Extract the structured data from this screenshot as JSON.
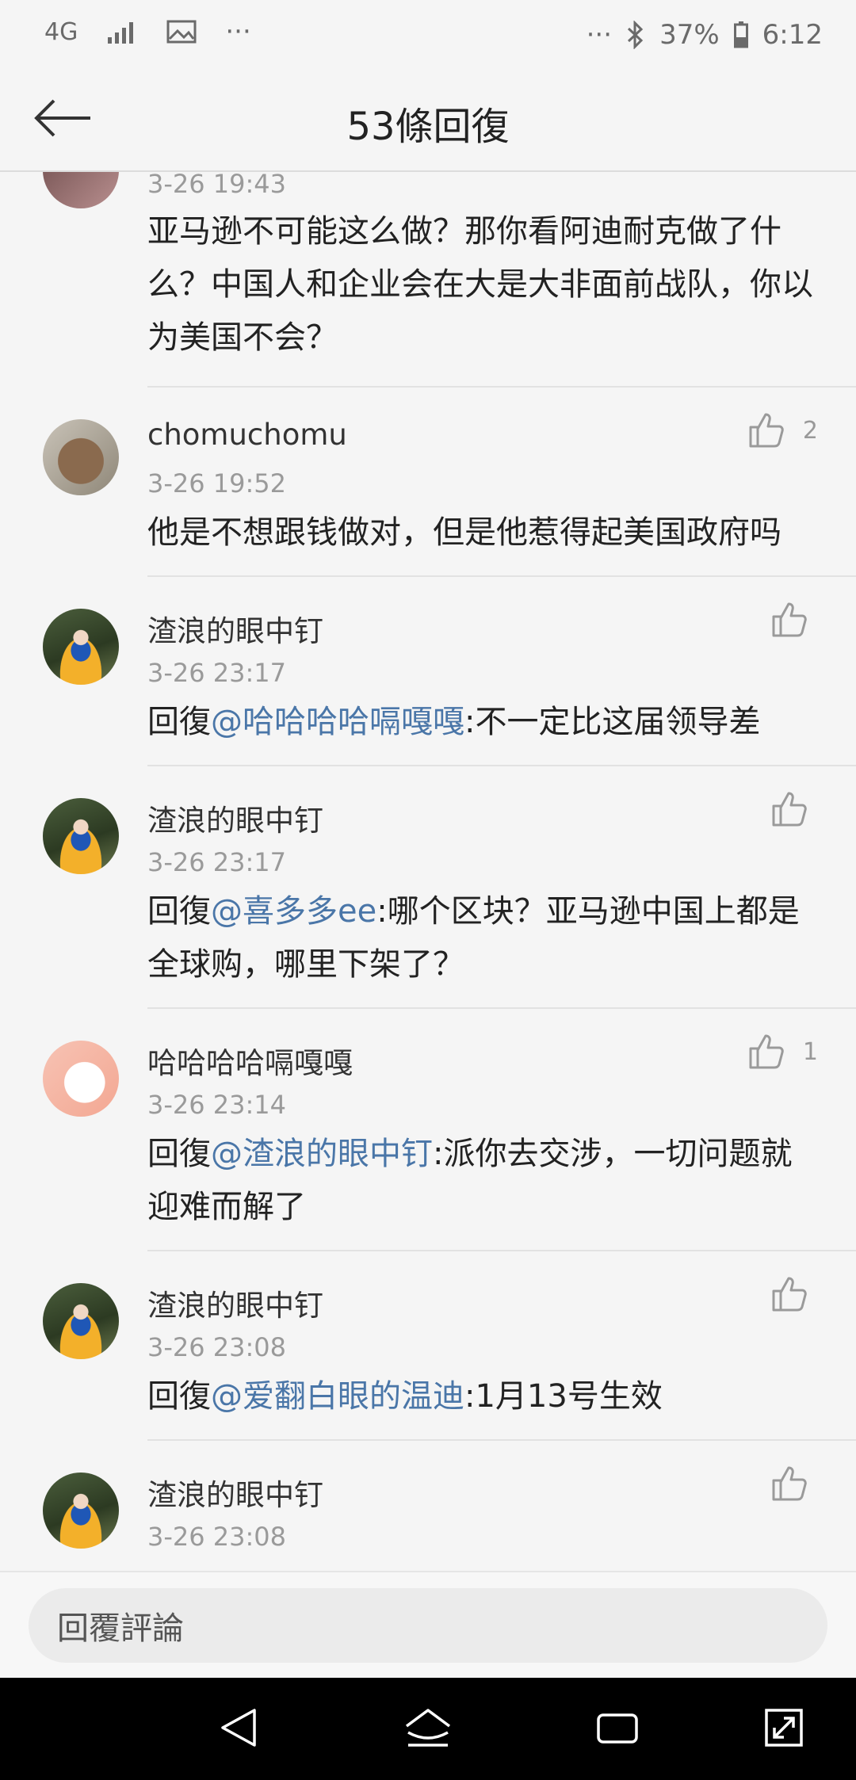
{
  "status_bar": {
    "network": "4G",
    "more": "···",
    "more_right": "···",
    "battery": "37%",
    "time": "6:12"
  },
  "header": {
    "title": "53條回復"
  },
  "comments": [
    {
      "time": "3-26 19:43",
      "text": "亚马逊不可能这么做？那你看阿迪耐克做了什么？中国人和企业会在大是大非面前战队，你以为美国不会？"
    },
    {
      "name": "chomuchomu",
      "time": "3-26 19:52",
      "likes": "2",
      "text": "他是不想跟钱做对，但是他惹得起美国政府吗"
    },
    {
      "name": "渣浪的眼中钉",
      "time": "3-26 23:17",
      "reply_prefix": "回復",
      "mention": "@哈哈哈哈嗝嘎嘎",
      "text": ":不一定比这届领导差"
    },
    {
      "name": "渣浪的眼中钉",
      "time": "3-26 23:17",
      "reply_prefix": "回復",
      "mention": "@喜多多ee",
      "text": ":哪个区块？亚马逊中国上都是全球购，哪里下架了？"
    },
    {
      "name": "哈哈哈哈嗝嘎嘎",
      "time": "3-26 23:14",
      "likes": "1",
      "reply_prefix": "回復",
      "mention": "@渣浪的眼中钉",
      "text": ":派你去交涉，一切问题就迎难而解了"
    },
    {
      "name": "渣浪的眼中钉",
      "time": "3-26 23:08",
      "reply_prefix": "回復",
      "mention": "@爱翻白眼的温迪",
      "text": ":1月13号生效"
    },
    {
      "name": "渣浪的眼中钉",
      "time": "3-26 23:08"
    }
  ],
  "reply_bar": {
    "placeholder": "回覆評論"
  },
  "icons": {
    "back": "arrow-left-icon",
    "like": "thumbs-up-icon",
    "nav_back": "triangle-back-icon",
    "nav_home": "home-icon",
    "nav_recent": "recent-apps-icon",
    "nav_expand": "expand-icon"
  },
  "colors": {
    "mention": "#4a76a8",
    "background": "#f5f5f5"
  }
}
